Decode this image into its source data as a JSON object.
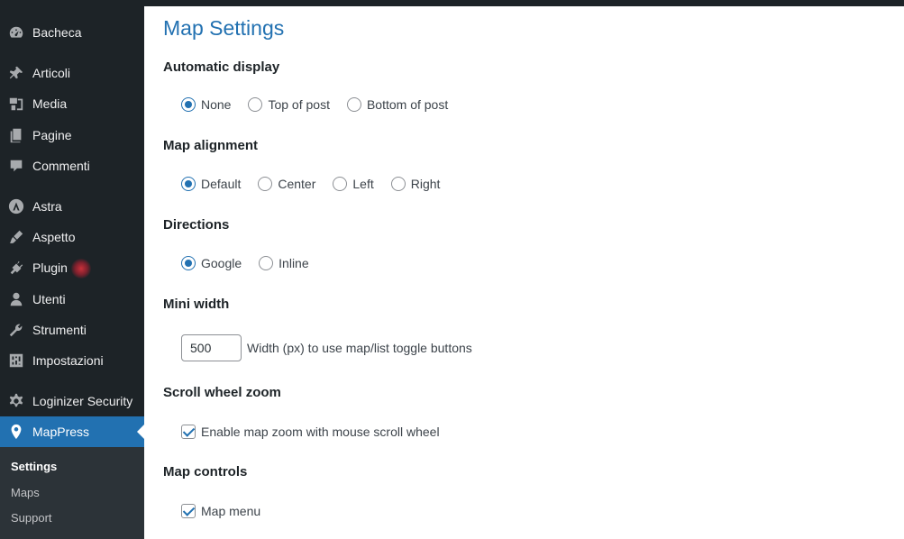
{
  "sidebar": {
    "items": [
      {
        "label": "Bacheca",
        "icon": "dashboard-icon"
      },
      {
        "label": "Articoli",
        "icon": "pin-icon"
      },
      {
        "label": "Media",
        "icon": "media-icon"
      },
      {
        "label": "Pagine",
        "icon": "pages-icon"
      },
      {
        "label": "Commenti",
        "icon": "comment-icon"
      },
      {
        "label": "Astra",
        "icon": "astra-icon"
      },
      {
        "label": "Aspetto",
        "icon": "brush-icon"
      },
      {
        "label": "Plugin",
        "icon": "plugin-icon"
      },
      {
        "label": "Utenti",
        "icon": "user-icon"
      },
      {
        "label": "Strumenti",
        "icon": "wrench-icon"
      },
      {
        "label": "Impostazioni",
        "icon": "settings-sliders-icon"
      },
      {
        "label": "Loginizer Security",
        "icon": "gear-icon"
      },
      {
        "label": "MapPress",
        "icon": "map-marker-icon"
      }
    ],
    "submenu": [
      "Settings",
      "Maps",
      "Support"
    ]
  },
  "page": {
    "title": "Map Settings"
  },
  "sections": {
    "automatic_display": {
      "title": "Automatic display",
      "options": [
        "None",
        "Top of post",
        "Bottom of post"
      ],
      "selected": "None"
    },
    "map_alignment": {
      "title": "Map alignment",
      "options": [
        "Default",
        "Center",
        "Left",
        "Right"
      ],
      "selected": "Default"
    },
    "directions": {
      "title": "Directions",
      "options": [
        "Google",
        "Inline"
      ],
      "selected": "Google"
    },
    "mini_width": {
      "title": "Mini width",
      "value": "500",
      "hint": "Width (px) to use map/list toggle buttons"
    },
    "scroll_wheel_zoom": {
      "title": "Scroll wheel zoom",
      "label": "Enable map zoom with mouse scroll wheel",
      "checked": true
    },
    "map_controls": {
      "title": "Map controls",
      "label": "Map menu",
      "checked": true
    }
  },
  "colors": {
    "sidebar_bg": "#1d2327",
    "accent": "#2271b1"
  }
}
